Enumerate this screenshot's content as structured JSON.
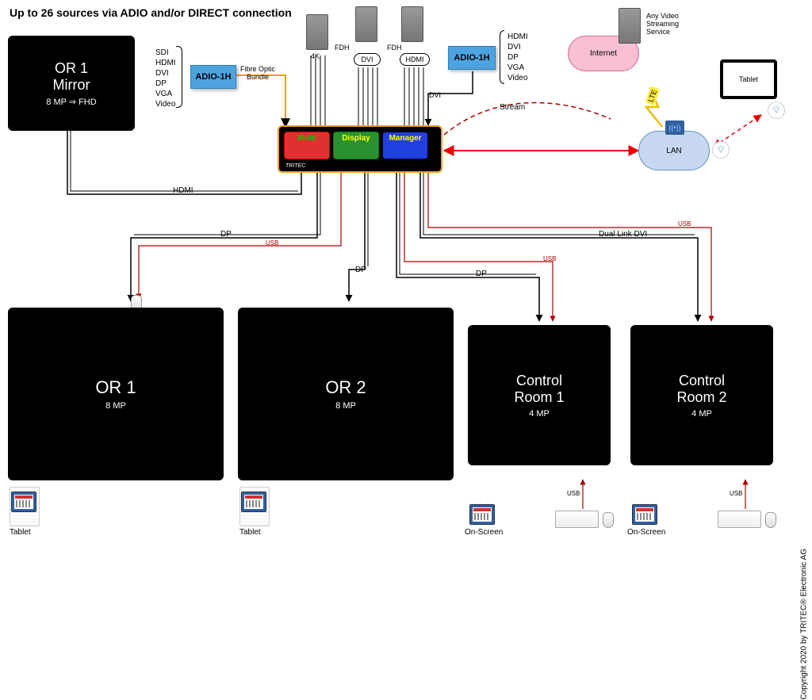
{
  "title": "Up to 26 sources via ADIO and/or DIRECT connection",
  "copyright": "Copyright 2020 by TRITEC® Electronic AG",
  "mirror": {
    "title": "OR 1\nMirror",
    "sub": "8 MP ⇒ FHD"
  },
  "adio_left": "ADIO-1H",
  "adio_right": "ADIO-1H",
  "signal_left_list": "SDI\nHDMI\nDVI\nDP\nVGA\nVideo",
  "signal_right_list": "HDMI\nDVI\nDP\nVGA\nVideo",
  "fibre_label": "Fibre Optic\nBundle",
  "srv_4k": "4K",
  "srv_fdh1": "FDH",
  "srv_fdh2": "FDH",
  "dvi_label1": "DVI",
  "hdmi_label2": "HDMI",
  "dvi_down": "DVI",
  "mdm": {
    "multi": "Multi",
    "display": "Display",
    "manager": "Manager",
    "logo": "TRITEC"
  },
  "internet": "Internet",
  "lan": "LAN",
  "stream_service": "Any Video\nStreaming\nService",
  "stream_label": "Stream",
  "lte": "LTE",
  "tablet_right": "Tablet",
  "conn": {
    "hdmi": "HDMI",
    "dp1": "DP",
    "dp2": "DP",
    "dp3": "DP",
    "dualdvi": "Dual Link DVI",
    "usb1": "USB",
    "usb2": "USB",
    "usb3": "USB",
    "usb4": "USB",
    "usb5": "USB"
  },
  "screens": {
    "or1": {
      "title": "OR 1",
      "sub": "8 MP"
    },
    "or2": {
      "title": "OR 2",
      "sub": "8 MP"
    },
    "cr1": {
      "title": "Control\nRoom 1",
      "sub": "4 MP"
    },
    "cr2": {
      "title": "Control\nRoom 2",
      "sub": "4 MP"
    }
  },
  "below": {
    "tablet": "Tablet",
    "onscreen": "On-Screen"
  }
}
